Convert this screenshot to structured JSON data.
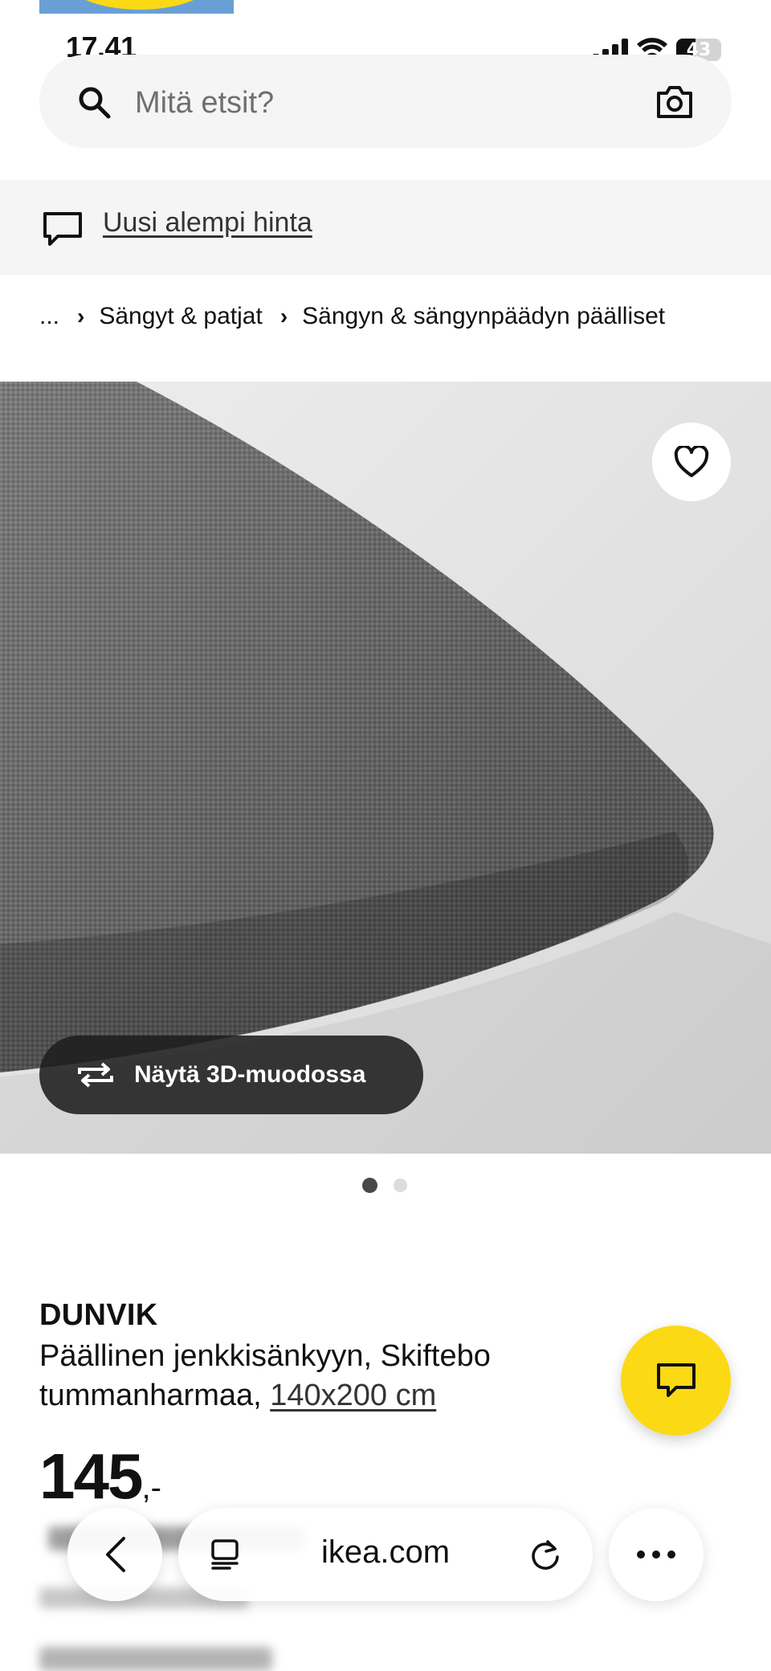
{
  "status_bar": {
    "time": "17.41",
    "battery_level": "43"
  },
  "search": {
    "placeholder": "Mitä etsit?",
    "value": ""
  },
  "promo": {
    "link_text": "Uusi alempi hinta"
  },
  "breadcrumb": {
    "ellipsis": "...",
    "items": [
      "Sängyt & patjat",
      "Sängyn & sängynpäädyn päälliset"
    ]
  },
  "media": {
    "view_3d_label": "Näytä 3D-muodossa",
    "image_count": 2,
    "active_index": 0
  },
  "product": {
    "name": "DUNVIK",
    "description_line1": "Päällinen jenkkisänkyyn, Skiftebo",
    "description_line2": "tummanharmaa,",
    "size": "140x200 cm",
    "price_main": "145",
    "price_suffix": ",-"
  },
  "browser": {
    "address": "ikea.com"
  },
  "colors": {
    "ikea_yellow": "#fbd914",
    "ikea_blue": "#6a9fd6",
    "light_gray": "#f5f5f5"
  },
  "icons": [
    "search-icon",
    "camera-icon",
    "chat-bubble-icon",
    "chevron-right-icon",
    "heart-icon",
    "rotate-3d-icon",
    "chat-icon",
    "chevron-left-icon",
    "tabs-icon",
    "reload-icon",
    "more-icon"
  ]
}
